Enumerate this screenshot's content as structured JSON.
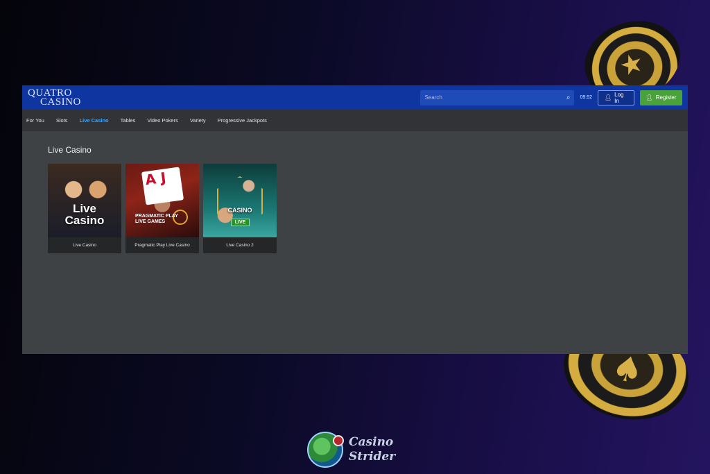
{
  "header": {
    "logo_line1": "QUATRO",
    "logo_line2": "CASINO",
    "search_placeholder": "Search",
    "clock": "09:52",
    "login_label": "Log In",
    "register_label": "Register"
  },
  "nav": {
    "items": [
      "For You",
      "Slots",
      "Live Casino",
      "Tables",
      "Video Pokers",
      "Variety",
      "Progressive Jackpots"
    ],
    "active": "Live Casino"
  },
  "main": {
    "section_title": "Live Casino",
    "cards": [
      {
        "label": "Live Casino",
        "art_text_1": "Live",
        "art_text_2": "Casino"
      },
      {
        "label": "Pragmatic Play Live Casino",
        "art_text_1": "PRAGMATIC PLAY",
        "art_text_2": "LIVE GAMES",
        "card_glyph": "A J"
      },
      {
        "label": "Live Casino 2",
        "art_text_1": "CASINO",
        "art_text_2": "LIVE"
      }
    ]
  },
  "watermark": {
    "line1": "Casino",
    "line2": "Strider"
  },
  "colors": {
    "topbar": "#0f36a0",
    "nav_active": "#3ea8ff",
    "register": "#4aa23a",
    "panel": "#3f4245"
  }
}
